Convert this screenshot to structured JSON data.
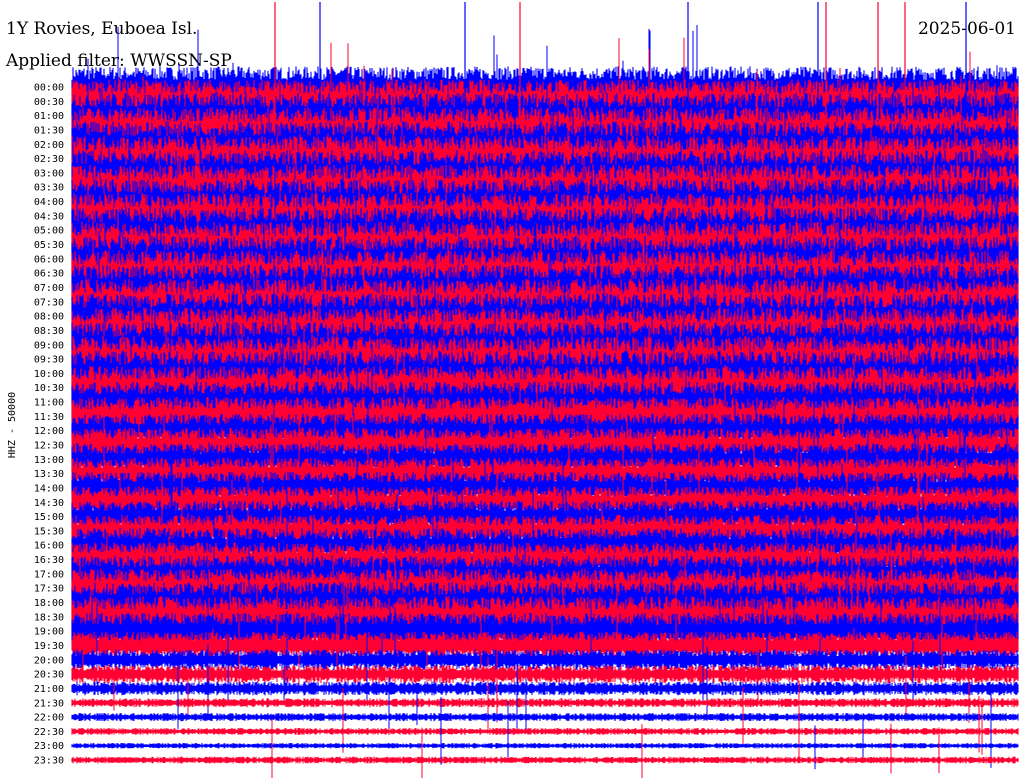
{
  "header": {
    "station": "1Y Rovies, Euboea Isl.",
    "date": "2025-06-01",
    "filter_text": "Applied filter: WWSSN-SP"
  },
  "chart_data": {
    "type": "line",
    "title": "1Y Rovies, Euboea Isl.",
    "date": "2025-06-01",
    "filter": "WWSSN-SP",
    "ylabel": "HHZ - 50000",
    "row_labels": [
      "00:00",
      "00:30",
      "01:00",
      "01:30",
      "02:00",
      "02:30",
      "03:00",
      "03:30",
      "04:00",
      "04:30",
      "05:00",
      "05:30",
      "06:00",
      "06:30",
      "07:00",
      "07:30",
      "08:00",
      "08:30",
      "09:00",
      "09:30",
      "10:00",
      "10:30",
      "11:00",
      "11:30",
      "12:00",
      "12:30",
      "13:00",
      "13:30",
      "14:00",
      "14:30",
      "15:00",
      "15:30",
      "16:00",
      "16:30",
      "17:00",
      "17:30",
      "18:00",
      "18:30",
      "19:00",
      "19:30",
      "20:00",
      "20:30",
      "21:00",
      "21:30",
      "22:00",
      "22:30",
      "23:00",
      "23:30"
    ],
    "colors": {
      "even_rows": "#0000ff",
      "odd_rows": "#ff0033",
      "background": "#ffffff"
    },
    "relative_amplitude": [
      0.9,
      0.95,
      1.0,
      1.0,
      1.0,
      1.0,
      1.0,
      1.0,
      1.0,
      1.0,
      1.0,
      1.0,
      1.0,
      1.0,
      1.0,
      1.0,
      1.0,
      1.0,
      1.0,
      1.0,
      1.0,
      0.95,
      0.9,
      0.85,
      0.75,
      0.75,
      0.7,
      0.7,
      0.7,
      0.7,
      0.7,
      0.7,
      0.75,
      0.75,
      0.8,
      0.85,
      0.9,
      0.9,
      0.8,
      0.6,
      0.45,
      0.4,
      0.3,
      0.2,
      0.18,
      0.15,
      0.12,
      0.15
    ]
  }
}
